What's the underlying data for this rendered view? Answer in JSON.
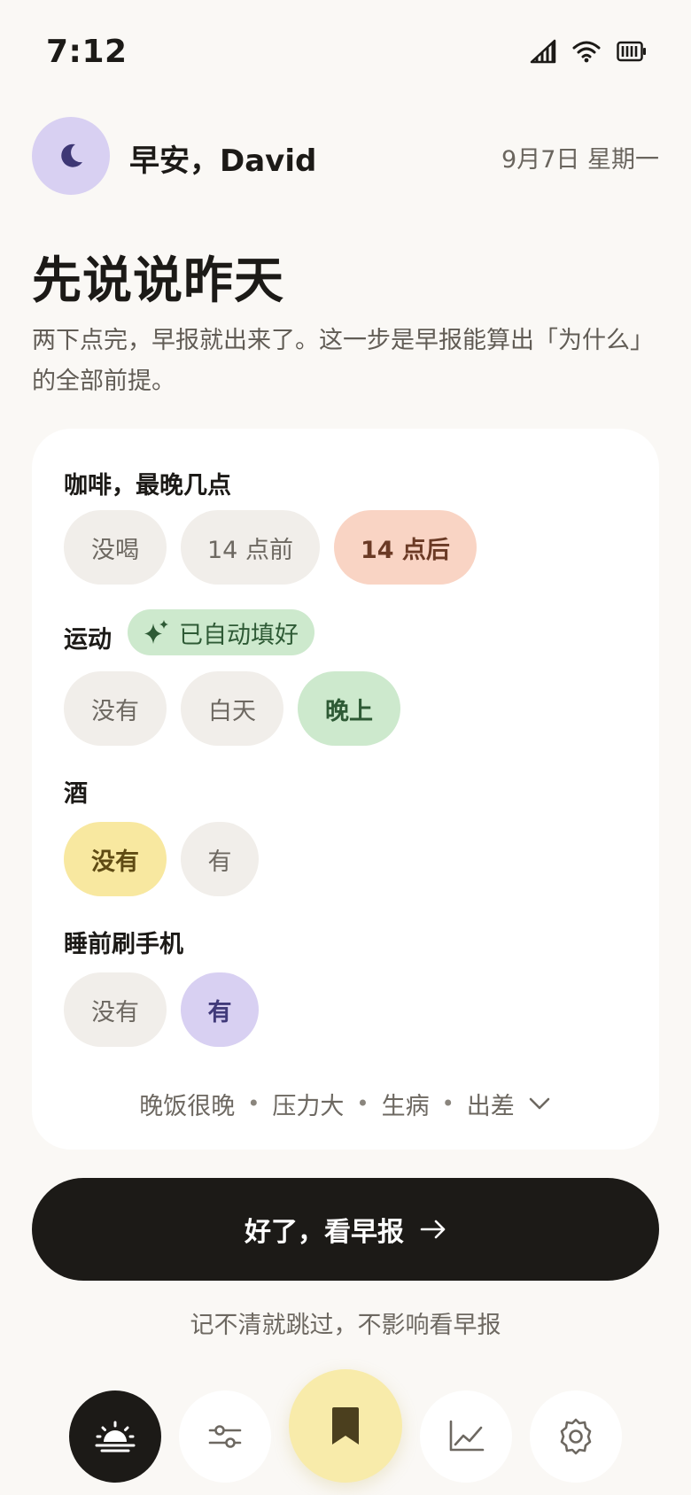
{
  "status": {
    "time": "7:12"
  },
  "header": {
    "greeting": "早安，David",
    "date": "9月7日 星期一"
  },
  "intro": {
    "title": "先说说昨天",
    "subtitle": "两下点完，早报就出来了。这一步是早报能算出「为什么」的全部前提。"
  },
  "questions": {
    "coffee": {
      "label": "咖啡，最晚几点",
      "options": [
        "没喝",
        "14 点前",
        "14 点后"
      ],
      "selected": "14 点后"
    },
    "exercise": {
      "label": "运动",
      "badge": "已自动填好",
      "options": [
        "没有",
        "白天",
        "晚上"
      ],
      "selected": "晚上"
    },
    "alcohol": {
      "label": "酒",
      "options": [
        "没有",
        "有"
      ],
      "selected": "没有"
    },
    "phone": {
      "label": "睡前刷手机",
      "options": [
        "没有",
        "有"
      ],
      "selected": "有"
    }
  },
  "more_tags": [
    "晚饭很晚",
    "压力大",
    "生病",
    "出差"
  ],
  "cta": {
    "label": "好了，看早报"
  },
  "skip_note": "记不清就跳过，不影响看早报",
  "colors": {
    "accent_dark": "#1c1a17",
    "coffee_selected": "#f9d4c4",
    "exercise_selected": "#cde9cd",
    "alcohol_selected": "#f8e8a0",
    "phone_selected": "#d8d0f2",
    "saved_nav": "#f8ebaa"
  },
  "nav": {
    "items": [
      "sunrise-icon",
      "sliders-icon",
      "bookmark-icon",
      "trend-icon",
      "gear-icon"
    ],
    "active": "sunrise-icon"
  }
}
